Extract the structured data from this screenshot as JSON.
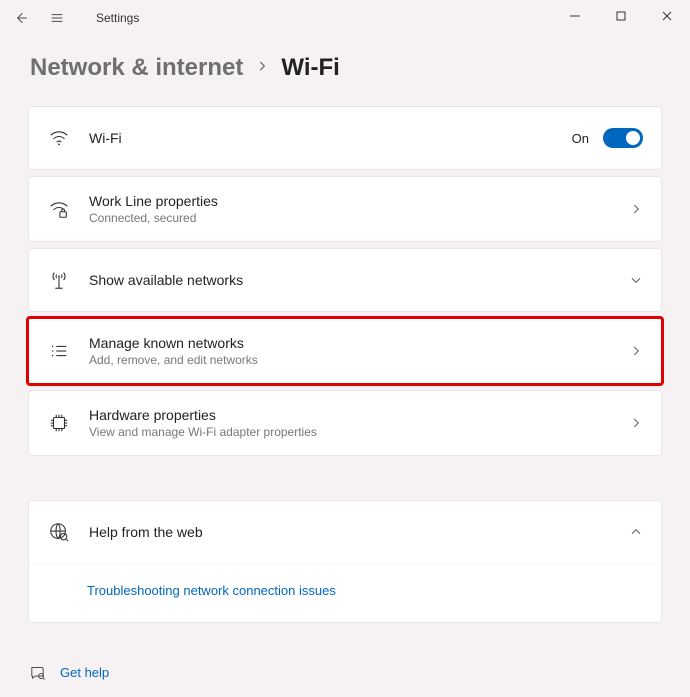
{
  "header": {
    "app_title": "Settings"
  },
  "breadcrumb": {
    "parent": "Network & internet",
    "current": "Wi-Fi"
  },
  "wifi": {
    "title": "Wi-Fi",
    "state_label": "On"
  },
  "properties": {
    "title": "Work Line properties",
    "sub": "Connected, secured"
  },
  "available": {
    "title": "Show available networks"
  },
  "known": {
    "title": "Manage known networks",
    "sub": "Add, remove, and edit networks"
  },
  "hardware": {
    "title": "Hardware properties",
    "sub": "View and manage Wi-Fi adapter properties"
  },
  "help": {
    "title": "Help from the web",
    "link": "Troubleshooting network connection issues"
  },
  "footer": {
    "get_help": "Get help"
  }
}
